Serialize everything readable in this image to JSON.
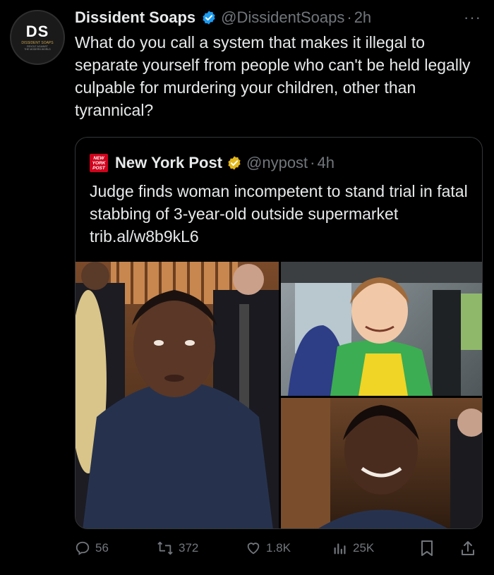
{
  "tweet": {
    "avatar": {
      "initials": "DS",
      "line1": "DISSIDENT SOAPS",
      "line2": "REVOLT AGAINST",
      "line3": "THE MODERN WORLD"
    },
    "display_name": "Dissident Soaps",
    "handle": "@DissidentSoaps",
    "separator": "·",
    "time": "2h",
    "more": "···",
    "text": "What do you call a system that makes it illegal to separate yourself from people who can't be held legally culpable for murdering your children, other than tyrannical?"
  },
  "quote": {
    "logo": {
      "l1": "NEW",
      "l2": "YORK",
      "l3": "POST"
    },
    "display_name": "New York Post",
    "handle": "@nypost",
    "separator": "·",
    "time": "4h",
    "text": "Judge finds woman incompetent to stand trial in fatal stabbing of 3-year-old outside supermarket trib.al/w8b9kL6"
  },
  "actions": {
    "replies": "56",
    "retweets": "372",
    "likes": "1.8K",
    "views": "25K"
  },
  "icons": {
    "verified": "verified-badge-icon",
    "gold_verified": "gold-verified-badge-icon",
    "reply": "reply-icon",
    "retweet": "retweet-icon",
    "like": "heart-icon",
    "views": "analytics-icon",
    "bookmark": "bookmark-icon",
    "share": "share-icon"
  },
  "colors": {
    "background": "#000000",
    "text": "#e7e9ea",
    "muted": "#71767b",
    "verified_blue": "#1d9bf0",
    "verified_gold": "#e2b719",
    "nyp_red": "#d0021b"
  }
}
